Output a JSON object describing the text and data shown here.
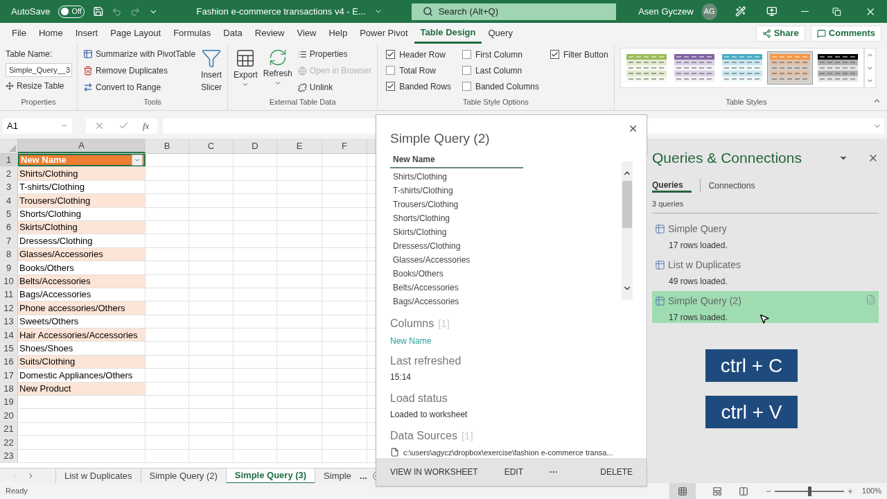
{
  "title_bar": {
    "autosave_label": "AutoSave",
    "autosave_on": false,
    "autosave_state": "Off",
    "document_title": "Fashion e-commerce transactions v4 - E...",
    "search_placeholder": "Search (Alt+Q)",
    "user_name": "Asen Gyczew",
    "user_initials": "AG"
  },
  "menu_tabs": [
    {
      "label": "File",
      "selected": false
    },
    {
      "label": "Home",
      "selected": false
    },
    {
      "label": "Insert",
      "selected": false
    },
    {
      "label": "Page Layout",
      "selected": false
    },
    {
      "label": "Formulas",
      "selected": false
    },
    {
      "label": "Data",
      "selected": false
    },
    {
      "label": "Review",
      "selected": false
    },
    {
      "label": "View",
      "selected": false
    },
    {
      "label": "Help",
      "selected": false
    },
    {
      "label": "Power Pivot",
      "selected": false
    },
    {
      "label": "Table Design",
      "selected": true
    },
    {
      "label": "Query",
      "selected": false
    }
  ],
  "share_button": "Share",
  "comments_button": "Comments",
  "ribbon": {
    "properties": {
      "table_name_label": "Table Name:",
      "table_name_value": "Simple_Query__3",
      "resize_table": "Resize Table",
      "group_label": "Properties"
    },
    "tools": {
      "summarize": "Summarize with PivotTable",
      "remove_duplicates": "Remove Duplicates",
      "convert": "Convert to Range",
      "insert_slicer": [
        "Insert",
        "Slicer"
      ],
      "group_label": "Tools"
    },
    "external": {
      "export": "Export",
      "refresh": "Refresh",
      "links": [
        {
          "label": "Properties",
          "disabled": false
        },
        {
          "label": "Open in Browser",
          "disabled": true
        },
        {
          "label": "Unlink",
          "disabled": false
        }
      ],
      "group_label": "External Table Data"
    },
    "style_options": {
      "columns": [
        [
          {
            "label": "Header Row",
            "checked": true
          },
          {
            "label": "Total Row",
            "checked": false
          },
          {
            "label": "Banded Rows",
            "checked": true
          }
        ],
        [
          {
            "label": "First Column",
            "checked": false
          },
          {
            "label": "Last Column",
            "checked": false
          },
          {
            "label": "Banded Columns",
            "checked": false
          }
        ],
        [
          {
            "label": "Filter Button",
            "checked": true
          }
        ]
      ],
      "group_label": "Table Style Options"
    },
    "table_styles": {
      "swatches": [
        {
          "color": "#9bbb59",
          "selected": false
        },
        {
          "color": "#8064a2",
          "selected": false
        },
        {
          "color": "#4bacc6",
          "selected": false
        },
        {
          "color": "#f79646",
          "selected": true
        },
        {
          "color": "#000000",
          "selected": false
        }
      ],
      "group_label": "Table Styles"
    }
  },
  "formula_bar": {
    "name_box": "A1",
    "fx": "fx"
  },
  "sheet": {
    "column_headers": [
      "A",
      "B",
      "C",
      "D",
      "E",
      "F"
    ],
    "row_numbers": [
      "1",
      "2",
      "3",
      "4",
      "5",
      "6",
      "7",
      "8",
      "9",
      "10",
      "11",
      "12",
      "13",
      "14",
      "15",
      "16",
      "17",
      "18",
      "19",
      "20",
      "21",
      "22",
      "23"
    ],
    "table_header": "New Name",
    "cells": [
      "Shirts/Clothing",
      "T-shirts/Clothing",
      "Trousers/Clothing",
      "Shorts/Clothing",
      "Skirts/Clothing",
      "Dressess/Clothing",
      "Glasses/Accessories",
      "Books/Others",
      "Belts/Accessories",
      "Bags/Accessories",
      "Phone accessories/Others",
      "Sweets/Others",
      "Hair Accessories/Accessories",
      "Shoes/Shoes",
      "Suits/Clothing",
      "Domestic Appliances/Others",
      "New Product"
    ]
  },
  "sheet_tabs": [
    {
      "label": "List w Duplicates",
      "selected": false
    },
    {
      "label": "Simple Query (2)",
      "selected": false
    },
    {
      "label": "Simple Query (3)",
      "selected": true
    },
    {
      "label": "Simple",
      "selected": false
    }
  ],
  "sheet_tabs_more": "...",
  "status_bar": {
    "text": "Ready",
    "zoom": "100%",
    "zoom_slider": {
      "level": 0.5
    }
  },
  "popup": {
    "title": "Simple Query (2)",
    "column_header": "New Name",
    "preview_rows": [
      "Shirts/Clothing",
      "T-shirts/Clothing",
      "Trousers/Clothing",
      "Shorts/Clothing",
      "Skirts/Clothing",
      "Dressess/Clothing",
      "Glasses/Accessories",
      "Books/Others",
      "Belts/Accessories",
      "Bags/Accessories"
    ],
    "columns_heading": "Columns",
    "columns_count": "[1]",
    "column_names": [
      "New Name"
    ],
    "last_refreshed_heading": "Last refreshed",
    "last_refreshed": "15:14",
    "load_status_heading": "Load status",
    "load_status": "Loaded to worksheet",
    "data_sources_heading": "Data Sources",
    "data_sources_count": "[1]",
    "data_source_path": "c:\\users\\agycz\\dropbox\\exercise\\fashion e-commerce transa...",
    "footer_buttons": [
      "VIEW IN WORKSHEET",
      "EDIT",
      "···",
      "DELETE"
    ]
  },
  "pane": {
    "title": "Queries & Connections",
    "tabs": [
      {
        "label": "Queries",
        "selected": true
      },
      {
        "label": "Connections",
        "selected": false
      }
    ],
    "count": "3 queries",
    "queries": [
      {
        "name": "Simple Query",
        "status": "17 rows loaded.",
        "selected": false
      },
      {
        "name": "List w Duplicates",
        "status": "49 rows loaded.",
        "selected": false
      },
      {
        "name": "Simple Query (2)",
        "status": "17 rows loaded.",
        "selected": true
      }
    ],
    "key_hints": [
      "ctrl + C",
      "ctrl + V"
    ]
  }
}
